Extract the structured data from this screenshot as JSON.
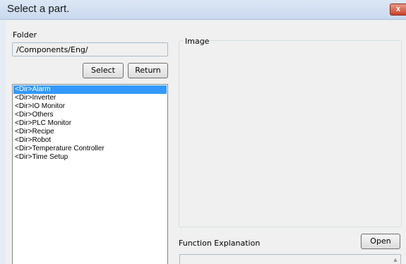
{
  "window": {
    "title": "Select a part.",
    "close_glyph": "x"
  },
  "folder": {
    "label": "Folder",
    "path": "/Components/Eng/"
  },
  "buttons": {
    "select": "Select",
    "return": "Return",
    "open": "Open"
  },
  "list": {
    "items": [
      {
        "label": "<Dir>Alarm",
        "selected": true
      },
      {
        "label": "<Dir>Inverter"
      },
      {
        "label": "<Dir>IO Monitor"
      },
      {
        "label": "<Dir>Others"
      },
      {
        "label": "<Dir>PLC Monitor"
      },
      {
        "label": "<Dir>Recipe"
      },
      {
        "label": "<Dir>Robot"
      },
      {
        "label": "<Dir>Temperature Controller"
      },
      {
        "label": "<Dir>Time Setup"
      }
    ]
  },
  "image_panel": {
    "label": "Image"
  },
  "function_panel": {
    "label": "Function Explanation"
  },
  "colors": {
    "selection": "#3399ff",
    "close": "#c9432b"
  },
  "icons": {
    "scroll_up": "scroll-up-arrow-icon",
    "close": "close-icon"
  }
}
